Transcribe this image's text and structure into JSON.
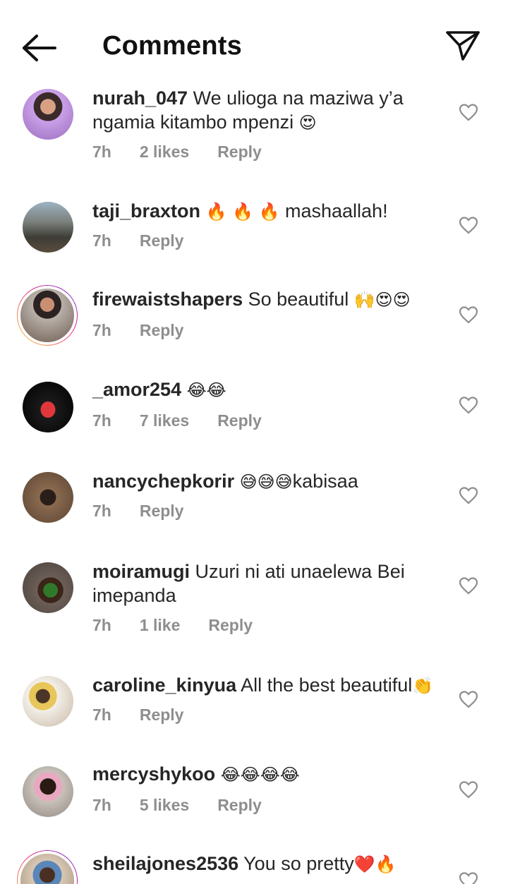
{
  "header": {
    "title": "Comments",
    "back_icon": "back-arrow-icon",
    "share_icon": "paper-plane-icon"
  },
  "comments": [
    {
      "username": "nurah_047",
      "text_line1": "We ulioga na maziwa y’a",
      "text_line2": "ngamia kitambo mpenzi",
      "emoji": "😍",
      "time": "7h",
      "likes": "2 likes",
      "reply": "Reply"
    },
    {
      "username": "taji_braxton",
      "emoji_before": "🔥 🔥 🔥",
      "text": "mashaallah!",
      "time": "7h",
      "reply": "Reply"
    },
    {
      "username": "firewaistshapers",
      "text": "So beautiful",
      "emoji": "🙌😍😍",
      "time": "7h",
      "reply": "Reply"
    },
    {
      "username": "_amor254",
      "emoji": "😂😂",
      "time": "7h",
      "likes": "7 likes",
      "reply": "Reply"
    },
    {
      "username": "nancychepkorir",
      "emoji_before": "😅😅😅",
      "text": "kabisaa",
      "time": "7h",
      "reply": "Reply"
    },
    {
      "username": "moiramugi",
      "text_line1": "Uzuri ni ati unaelewa Bei",
      "text_line2": "imepanda",
      "time": "7h",
      "likes": "1 like",
      "reply": "Reply"
    },
    {
      "username": "caroline_kinyua",
      "text": "All the best beautiful",
      "emoji": "👏",
      "time": "7h",
      "reply": "Reply"
    },
    {
      "username": "mercyshykoo",
      "emoji": "😂😂😂😂",
      "time": "7h",
      "likes": "5 likes",
      "reply": "Reply"
    },
    {
      "username": "sheilajones2536",
      "text": "You  so pretty",
      "emoji": "❤️🔥"
    }
  ],
  "colors": {
    "meta_gray": "#8e8e8e",
    "text": "#262626",
    "story_ring": "#ee2a7b"
  }
}
